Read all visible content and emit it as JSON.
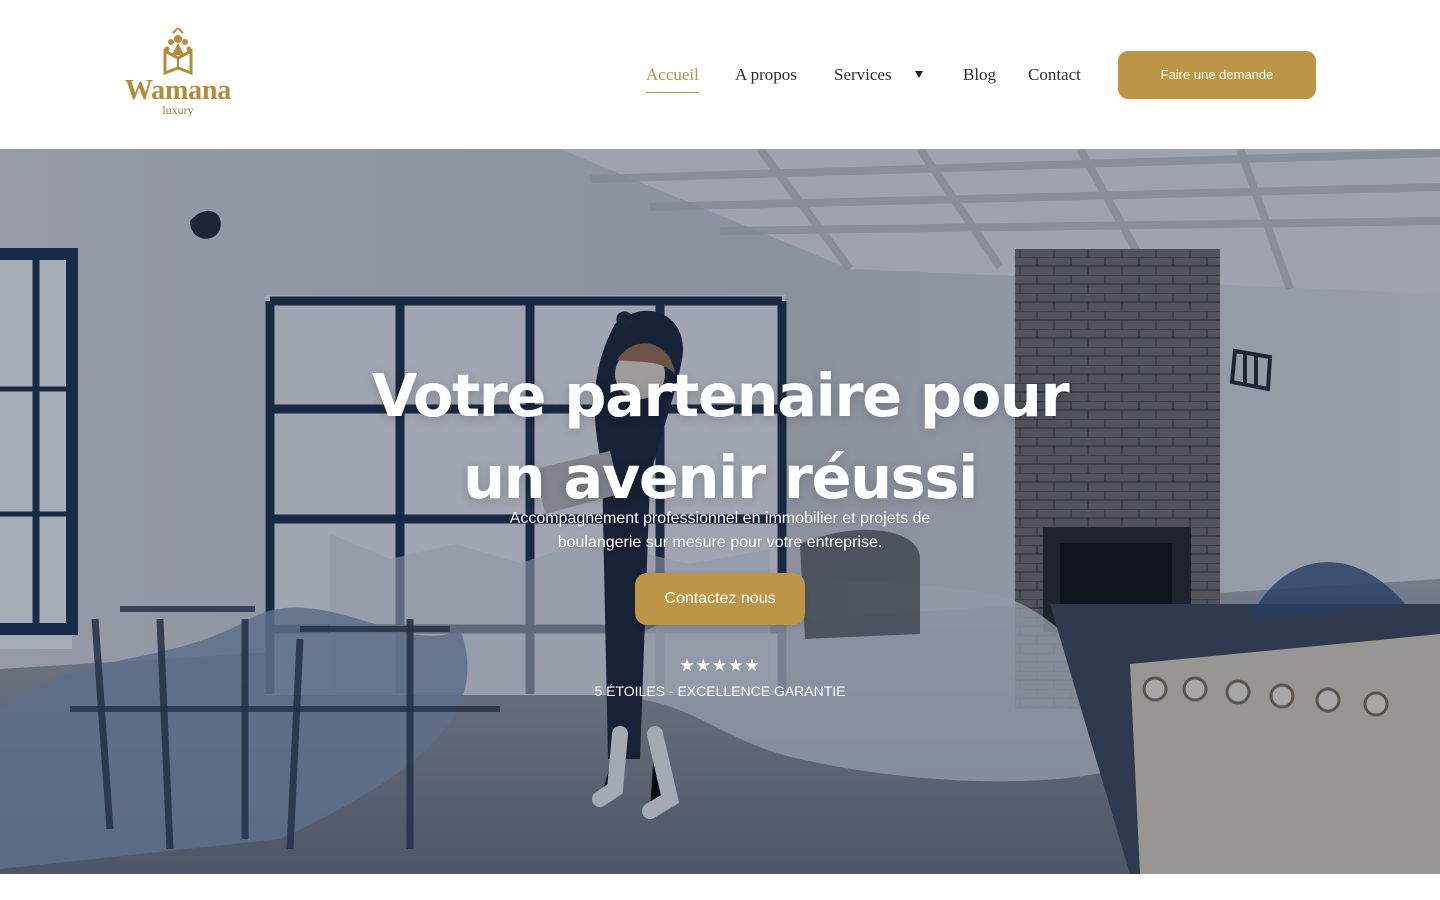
{
  "brand": {
    "name": "Wamana",
    "subtitle": "luxury",
    "logo_icon": "crown-book-icon",
    "gold": "#bd9545",
    "text": "#2c2c2c"
  },
  "navigation": {
    "items": [
      {
        "label": "Accueil",
        "active": true
      },
      {
        "label": "A propos",
        "active": false
      },
      {
        "label": "Services",
        "active": false,
        "icon": "chevron-down-icon"
      },
      {
        "label": "Blog",
        "active": false
      },
      {
        "label": "Contact",
        "active": false
      }
    ],
    "cta_label": "Faire une demande"
  },
  "hero": {
    "title_line_1": "Votre partenaire pour",
    "title_line_2": "un avenir réussi",
    "subtitle_line_1": "Accompagnement professionnel en immobilier et projets de",
    "subtitle_line_2": "boulangerie sur mesure pour votre entreprise.",
    "button_label": "Contactez nous",
    "stars": "★★★★★",
    "rating_label": "5 ÉTOILES - EXCELLENCE GARANTIE"
  }
}
